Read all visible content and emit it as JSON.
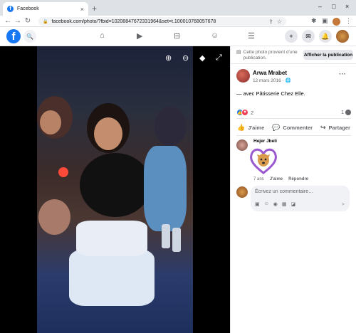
{
  "browser": {
    "tab_title": "Facebook",
    "favicon_letter": "f",
    "tab_close": "×",
    "new_tab": "+",
    "url": "facebook.com/photo/?fbid=10208847672331964&set=t.100010768057678",
    "win_min": "–",
    "win_max": "□",
    "win_close": "×"
  },
  "fb": {
    "logo": "f",
    "nav_icons": [
      "home-icon",
      "watch-icon",
      "marketplace-icon",
      "groups-icon",
      "menu-icon"
    ]
  },
  "panel": {
    "notice": "Cette photo provient d'une publication.",
    "view_post": "Afficher la publication",
    "author": "Arwa Mrabet",
    "date": "12 mars 2016 ·",
    "with_text": "— avec Pâtisserie Chez Elle.",
    "reaction_count": "2",
    "comment_count": "1",
    "like": "J'aime",
    "comment": "Commenter",
    "share": "Partager",
    "commenter": "Hejer Jbeli",
    "comment_age": "7 ans",
    "comment_like": "J'aime",
    "comment_reply": "Répondre",
    "composer_placeholder": "Écrivez un commentaire…"
  },
  "colors": {
    "fb_blue": "#1877f2",
    "secondary_text": "#65676b",
    "like_blue": "#1877f2",
    "love_red": "#f33e58"
  }
}
